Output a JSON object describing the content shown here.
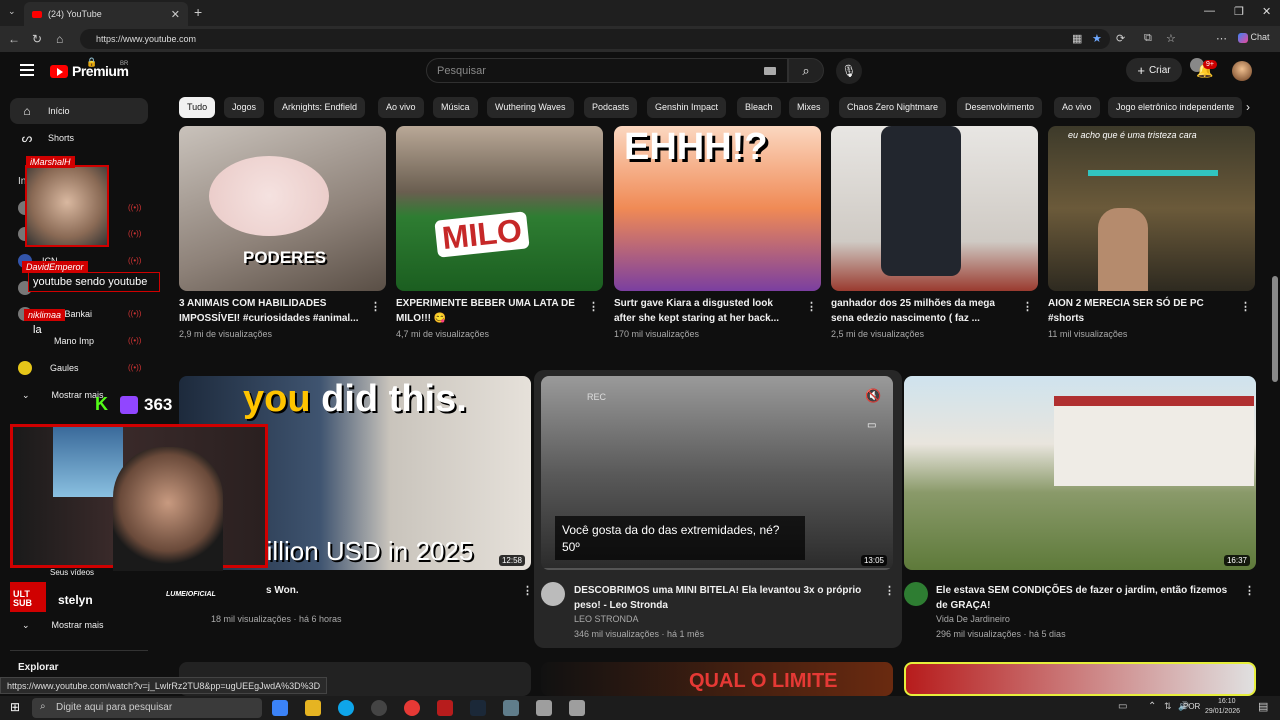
{
  "browser": {
    "tab_title": "(24) YouTube",
    "url": "https://www.youtube.com",
    "chat_label": "Chat",
    "status_url": "https://www.youtube.com/watch?v=j_LwlrRz2TU8&pp=ugUEEgJwdA%3D%3D"
  },
  "header": {
    "logo_text": "Premium",
    "logo_region": "BR",
    "search_placeholder": "Pesquisar",
    "create_label": "Criar",
    "notif_count": "9+"
  },
  "sidebar": {
    "items": [
      {
        "label": "Início",
        "icon": "home-icon"
      },
      {
        "label": "Shorts",
        "icon": "shorts-icon"
      }
    ],
    "subs_heading": "Insc",
    "subs": [
      {
        "label": "ICN"
      },
      {
        "label": "ral Bankai"
      },
      {
        "label": "Mano Imp"
      },
      {
        "label": "Gaules"
      }
    ],
    "show_more_1": "Mostrar mais",
    "your_videos": "Seus vídeos",
    "show_more_2": "Mostrar mais",
    "explore": "Explorar"
  },
  "chips": [
    "Tudo",
    "Jogos",
    "Arknights: Endfield",
    "Ao vivo",
    "Música",
    "Wuthering Waves",
    "Podcasts",
    "Genshin Impact",
    "Bleach",
    "Mixes",
    "Chaos Zero Nightmare",
    "Desenvolvimento",
    "Ao vivo",
    "Jogo eletrônico independente"
  ],
  "row1": [
    {
      "title1": "3 ANIMAIS COM HABILIDADES",
      "title2": "IMPOSSÍVEI! #curiosidades #animal...",
      "meta": "2,9 mi de visualizações",
      "thumb_text": "PODERES"
    },
    {
      "title1": "EXPERIMENTE BEBER UMA LATA DE",
      "title2": "MILO!!! 😋",
      "meta": "4,7 mi de visualizações",
      "thumb_text": "MILO"
    },
    {
      "title1": "Surtr gave Kiara a disgusted look",
      "title2": "after she kept staring at her back...",
      "meta": "170 mil visualizações",
      "thumb_text": "EHHH!?"
    },
    {
      "title1": "ganhador dos 25 milhões da mega",
      "title2": "sena edezio nascimento ( faz ...",
      "meta": "2,5 mi de visualizações",
      "thumb_text": ""
    },
    {
      "title1": "AION 2 MERECIA SER SÓ DE PC",
      "title2": "#shorts",
      "meta": "11 mil visualizações",
      "thumb_text": "eu acho que é uma tristeza cara"
    }
  ],
  "row2": [
    {
      "title1": "s Won.",
      "title2": "",
      "channel": "",
      "meta": "18 mil visualizações · há 6 horas",
      "duration": "12:58",
      "thumb_top": "you did this.",
      "thumb_bottom": "million USD in 2025"
    },
    {
      "title1": "DESCOBRIMOS uma MINI BITELA! Ela levantou 3x o próprio",
      "title2": "peso! - Leo Stronda",
      "channel": "LEO STRONDA",
      "meta": "346 mil visualizações · há 1 mês",
      "duration": "13:05",
      "caption1": "Você gosta da do das extremidades, né?",
      "caption2": "50º",
      "rec": "REC"
    },
    {
      "title1": "Ele estava SEM CONDIÇÕES de fazer o jardim, então fizemos",
      "title2": "de GRAÇA!",
      "channel": "Vida De Jardineiro",
      "meta": "296 mil visualizações · há 5 dias",
      "duration": "16:37"
    }
  ],
  "row3_thumb_text": "QUAL O LIMITE",
  "stream": {
    "name1": "iMarshalH",
    "name2": "DavidEmperor",
    "msg2": "youtube sendo youtube",
    "name3": "niklimaa",
    "msg3": "la",
    "viewers": "363",
    "k_label": "K",
    "chatter": "stelyn",
    "sponsor": "LUMEIOFICIAL",
    "badge": "ULT SUB"
  },
  "taskbar": {
    "search": "Digite aqui para pesquisar",
    "lang": "POR",
    "time": "16:10",
    "date": "29/01/2026"
  }
}
